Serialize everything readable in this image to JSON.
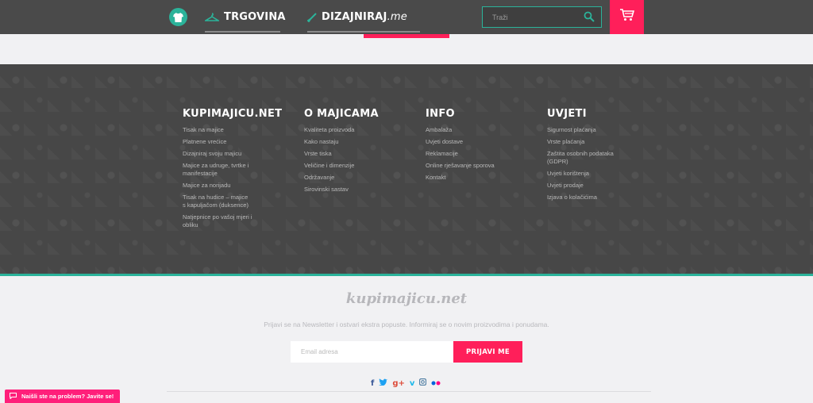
{
  "header": {
    "nav": [
      {
        "label": "TRGOVINA"
      },
      {
        "label_main": "DIZAJNIRAJ",
        "label_suffix": ".me"
      }
    ],
    "search": {
      "placeholder": "Traži"
    },
    "colors": {
      "header_bg": "#4a4a4a",
      "accent_pink": "#ff1f5a",
      "accent_teal": "#2bb39a"
    }
  },
  "footer": {
    "columns": [
      {
        "title": "KUPIMAJICU.NET",
        "links": [
          "Tisak na majice",
          "Platnene vrećice",
          "Dizajniraj svoju majicu",
          "Majice za udruge, tvrtke i manifestacije",
          "Majice za norijadu",
          "Tisak na hudice – majice s kapuljačom (duksence)",
          "Natjepnice po vašoj mjeri i obliku"
        ]
      },
      {
        "title": "O MAJICAMA",
        "links": [
          "Kvaliteta proizvoda",
          "Kako nastaju",
          "Vrste tiska",
          "Veličine i dimenzije",
          "Održavanje",
          "Sirovinski sastav"
        ]
      },
      {
        "title": "INFO",
        "links": [
          "Ambalaža",
          "Uvjeti dostave",
          "Reklamacije",
          "Online rješavanje sporova",
          "Kontakt"
        ]
      },
      {
        "title": "UVJETI",
        "links": [
          "Sigurnost plaćanja",
          "Vrste plaćanja",
          "Zaštita osobnih podataka (GDPR)",
          "Uvjeti korištenja",
          "Uvjeti prodaje",
          "Izjava o kolačićima"
        ]
      }
    ]
  },
  "newsletter": {
    "brand": "kupimajicu.net",
    "tagline": "Prijavi se na Newsletter i ostvari ekstra popuste. Informiraj se o novim proizvodima i ponudama.",
    "email_placeholder": "Email adresa",
    "button_label": "PRIJAVI ME"
  },
  "social": {
    "icons": [
      "facebook-icon",
      "twitter-icon",
      "google-plus-icon",
      "vimeo-icon",
      "instagram-icon",
      "flickr-icon"
    ]
  },
  "help_tab": {
    "label": "Naišli ste na problem? Javite se!"
  }
}
